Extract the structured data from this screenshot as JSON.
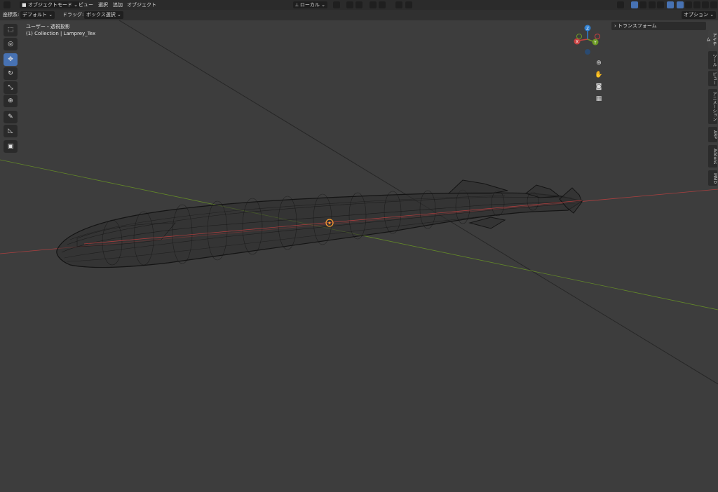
{
  "header": {
    "mode_label": "オブジェクトモード",
    "menu": [
      "ビュー",
      "選択",
      "追加",
      "オブジェクト"
    ],
    "transform_orientation": "ローカル"
  },
  "subheader": {
    "coord_label": "座標系:",
    "coord_value": "デフォルト",
    "drag_label": "ドラッグ:",
    "drag_value": "ボックス選択",
    "options_label": "オプション"
  },
  "viewport": {
    "title": "ユーザー・透視投影",
    "collection": "(1) Collection | Lamprey_Tex"
  },
  "gizmo": {
    "z": "Z",
    "x": "X",
    "y": "Y"
  },
  "npanel": {
    "transform_label": "トランスフォーム"
  },
  "tabs": [
    "アイテム",
    "ツール",
    "ビュー",
    "アニメーション",
    "ARP",
    "Addons",
    "MMD"
  ],
  "colors": {
    "axis_x": "#c84040",
    "axis_y": "#6c9a24",
    "axis_z": "#2f7fd0",
    "active": "#4772b3",
    "origin": "#ffa030"
  }
}
